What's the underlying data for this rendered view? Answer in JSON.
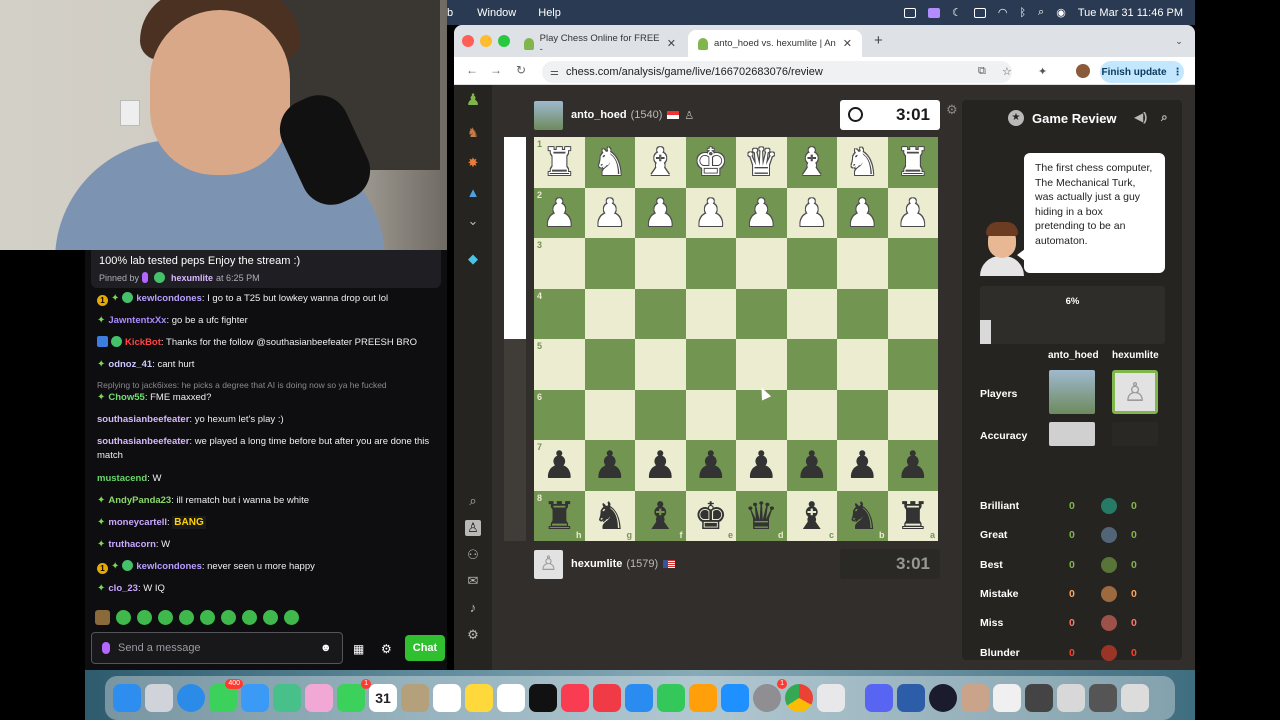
{
  "menubar": {
    "app_fragment": "b",
    "items": [
      "Window",
      "Help"
    ],
    "datetime": "Tue Mar 31  11:46 PM"
  },
  "browser": {
    "tabs": [
      {
        "title": "Play Chess Online for FREE - ",
        "active": false
      },
      {
        "title": "anto_hoed vs. hexumlite | An",
        "active": true
      }
    ],
    "url": "chess.com/analysis/game/live/166702683076/review",
    "finish_update": "Finish update"
  },
  "chat": {
    "pinned": {
      "message": "100% lab tested peps Enjoy the stream :)",
      "pinned_by_prefix": "Pinned by",
      "pinned_by_user": "hexumlite",
      "pinned_time": "at 6:25 PM"
    },
    "messages": [
      {
        "user": "kewlcondones",
        "color": "#b8a0ff",
        "text": "I go to a T25 but lowkey wanna drop out lol"
      },
      {
        "user": "JawntentxXx",
        "color": "#a98bff",
        "text": "go be a ufc fighter"
      },
      {
        "user": "KickBot",
        "color": "#ff4545",
        "text": "Thanks for the follow @southasianbeefeater PREESH BRO"
      },
      {
        "user": "odnoz_41",
        "color": "#c8c8ff",
        "text": "cant hurt"
      },
      {
        "user": "Chow55",
        "color": "#6fe06f",
        "text": "FME maxxed?"
      },
      {
        "user": "southasianbeefeater",
        "color": "#d7b8ff",
        "text": "yo hexum let's play :)"
      },
      {
        "user": "southasianbeefeater",
        "color": "#d7b8ff",
        "text": "we played a long time before but after you are done this match"
      },
      {
        "user": "mustacend",
        "color": "#67d767",
        "text": "W"
      },
      {
        "user": "AndyPanda23",
        "color": "#8ad86b",
        "text": "ill rematch but i wanna be white"
      },
      {
        "user": "moneycartell",
        "color": "#c8a8ff",
        "text": "BANG"
      },
      {
        "user": "truthacorn",
        "color": "#c8a8ff",
        "text": "W"
      },
      {
        "user": "kewlcondones",
        "color": "#b8a0ff",
        "text": "never seen u more happy"
      },
      {
        "user": "clo_23",
        "color": "#c8a8ff",
        "text": "W IQ"
      }
    ],
    "reply_note": "Replying to jack6ixes: he picks a degree that AI is doing now so ya he fucked",
    "input_placeholder": "Send a message",
    "chat_button": "Chat"
  },
  "game": {
    "top_player": {
      "name": "anto_hoed",
      "rating": "(1540)",
      "clock": "3:01"
    },
    "bottom_player": {
      "name": "hexumlite",
      "rating": "(1579)",
      "clock": "3:01"
    },
    "ranks": [
      "1",
      "2",
      "3",
      "4",
      "5",
      "6",
      "7",
      "8"
    ],
    "files": [
      "h",
      "g",
      "f",
      "e",
      "d",
      "c",
      "b",
      "a"
    ],
    "board": [
      [
        "wR",
        "wN",
        "wB",
        "wK",
        "wQ",
        "wB",
        "wN",
        "wR"
      ],
      [
        "wP",
        "wP",
        "wP",
        "wP",
        "wP",
        "wP",
        "wP",
        "wP"
      ],
      [
        "",
        "",
        "",
        "",
        "",
        "",
        "",
        ""
      ],
      [
        "",
        "",
        "",
        "",
        "",
        "",
        "",
        ""
      ],
      [
        "",
        "",
        "",
        "",
        "",
        "",
        "",
        ""
      ],
      [
        "",
        "",
        "",
        "",
        "",
        "",
        "",
        ""
      ],
      [
        "bP",
        "bP",
        "bP",
        "bP",
        "bP",
        "bP",
        "bP",
        "bP"
      ],
      [
        "bR",
        "bN",
        "bB",
        "bK",
        "bQ",
        "bB",
        "bN",
        "bR"
      ]
    ]
  },
  "review": {
    "title": "Game Review",
    "coach_message": "The first chess computer, The Mechanical Turk, was actually just a guy hiding in a box pretending to be an automaton.",
    "progress": "6%",
    "progress_value": 0.06,
    "players_label": "Players",
    "accuracy_label": "Accuracy",
    "player_white": "anto_hoed",
    "player_black": "hexumlite",
    "classifications": [
      {
        "label": "Brilliant",
        "white": "0",
        "black": "0",
        "color": "#26c2a3"
      },
      {
        "label": "Great",
        "white": "0",
        "black": "0",
        "color": "#749bbf"
      },
      {
        "label": "Best",
        "white": "0",
        "black": "0",
        "color": "#81b64c"
      },
      {
        "label": "Mistake",
        "white": "0",
        "black": "0",
        "color": "#ffa459"
      },
      {
        "label": "Miss",
        "white": "0",
        "black": "0",
        "color": "#ff7769"
      },
      {
        "label": "Blunder",
        "white": "0",
        "black": "0",
        "color": "#fa412d"
      }
    ]
  },
  "dock": {
    "calendar_day": "31",
    "badges": {
      "messages": "400",
      "facetime": "1",
      "settings": "1"
    }
  }
}
